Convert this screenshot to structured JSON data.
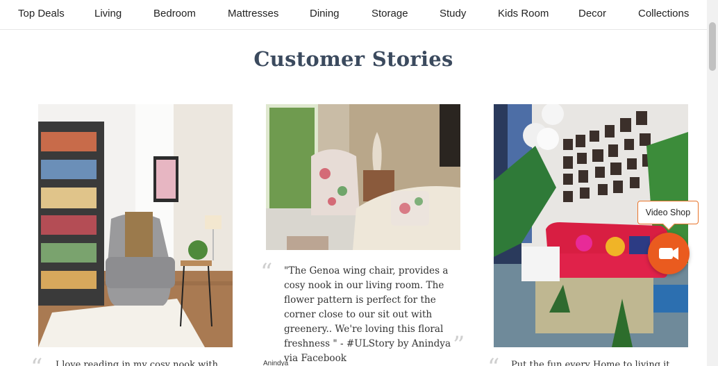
{
  "nav": {
    "items": [
      {
        "label": "Top Deals"
      },
      {
        "label": "Living"
      },
      {
        "label": "Bedroom"
      },
      {
        "label": "Mattresses"
      },
      {
        "label": "Dining"
      },
      {
        "label": "Storage"
      },
      {
        "label": "Study"
      },
      {
        "label": "Kids Room"
      },
      {
        "label": "Decor"
      },
      {
        "label": "Collections"
      }
    ]
  },
  "section": {
    "title": "Customer Stories"
  },
  "stories": [
    {
      "image_desc": "grey recliner in bright room with bookshelf",
      "caption_partial": "I love reading in my cosy nook with"
    },
    {
      "image_desc": "floral wing chair in living room",
      "text": "\"The Genoa wing chair, provides a cosy nook in our living room. The flower pattern is perfect for the corner close to our sit out with greenery.. We're loving this floral freshness \" - #ULStory by Anindya via Facebook",
      "author_partial": "Anindya"
    },
    {
      "image_desc": "red sofa with colourful cushions and gallery wall",
      "caption_partial": "Put the fun every Home to living it"
    }
  ],
  "video_shop": {
    "label": "Video Shop",
    "icon": "video-camera-icon"
  },
  "colors": {
    "accent": "#ea5b1f",
    "title": "#3b4a5e"
  }
}
